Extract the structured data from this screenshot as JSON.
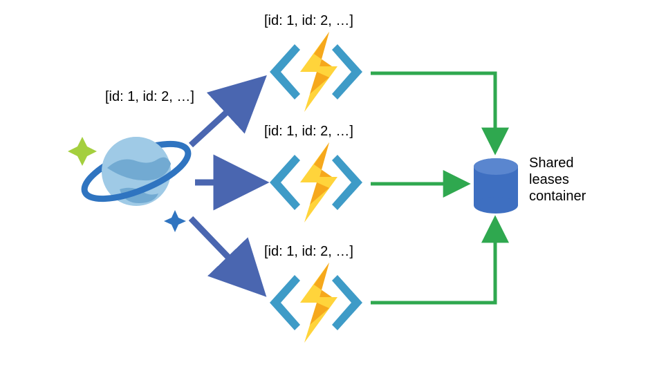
{
  "labels": {
    "source": "[id: 1, id: 2, …]",
    "fn_top": "[id: 1, id: 2, …]",
    "fn_mid": "[id: 1, id: 2, …]",
    "fn_bot": "[id: 1, id: 2, …]",
    "db": "Shared\nleases\ncontainer"
  },
  "colors": {
    "blue_arrow": "#4A66B0",
    "green_arrow": "#2FA84F",
    "planet_ring": "#2F74C0",
    "planet_light": "#9FCAE6",
    "planet_dark": "#6AA4CE",
    "star_green": "#A4CF3E",
    "star_blue": "#2F74C0",
    "fn_bracket": "#3E9BC7",
    "bolt1": "#FFD43B",
    "bolt2": "#F6A81C",
    "db_fill": "#3E6FC1"
  }
}
